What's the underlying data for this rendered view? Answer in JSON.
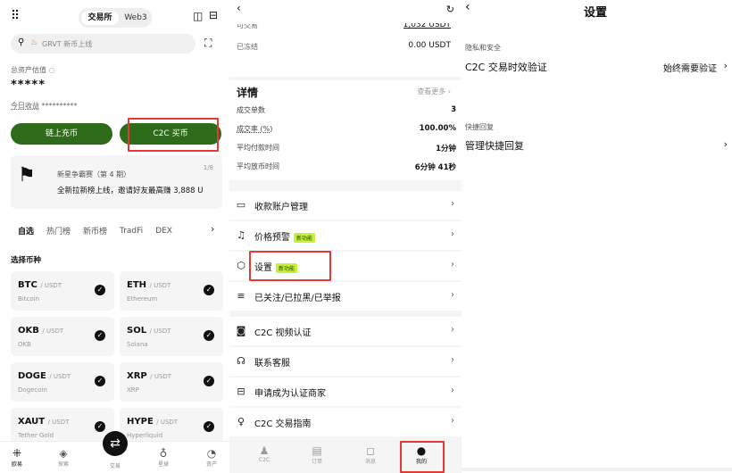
{
  "left": {
    "seg_on": "交易所",
    "seg_off": "Web3",
    "search_placeholder": "GRVT 新币上线",
    "assets_label": "总资产估值",
    "assets_value": "*****",
    "income_label": "今日收益",
    "income_value": "**********",
    "btn_deposit": "链上充币",
    "btn_c2c": "C2C 买币",
    "promo_title": "新星争霸赛（第 4 期）",
    "promo_counter": "1/8",
    "promo_text": "全新拉新榜上线，邀请好友最高赚 3,888 U",
    "tabs": [
      "自选",
      "热门榜",
      "新币榜",
      "TradFi",
      "DEX"
    ],
    "section": "选择币种",
    "coins": [
      {
        "sym": "BTC",
        "quote": "/ USDT",
        "name": "Bitcoin"
      },
      {
        "sym": "ETH",
        "quote": "/ USDT",
        "name": "Ethereum"
      },
      {
        "sym": "OKB",
        "quote": "/ USDT",
        "name": "OKB"
      },
      {
        "sym": "SOL",
        "quote": "/ USDT",
        "name": "Solana"
      },
      {
        "sym": "DOGE",
        "quote": "/ USDT",
        "name": "Dogecoin"
      },
      {
        "sym": "XRP",
        "quote": "/ USDT",
        "name": "XRP"
      },
      {
        "sym": "XAUT",
        "quote": "/ USDT",
        "name": "Tether Gold"
      },
      {
        "sym": "HYPE",
        "quote": "/ USDT",
        "name": "Hyperliquid"
      }
    ],
    "nav": [
      "欧易",
      "探索",
      "交易",
      "星球",
      "资产"
    ]
  },
  "middle": {
    "avail_label": "可交易",
    "avail_value": "1,032 USDT",
    "frozen_label": "已冻结",
    "frozen_value": "0.00 USDT",
    "details_title": "详情",
    "see_more": "查看更多 ›",
    "details": [
      {
        "k": "成交单数",
        "v": "3"
      },
      {
        "k": "成交率 (%)",
        "v": "100.00%"
      },
      {
        "k": "平均付款时间",
        "v": "1分钟"
      },
      {
        "k": "平均放币时间",
        "v": "6分钟 41秒"
      }
    ],
    "menu": [
      {
        "label": "收款账户管理",
        "icon": "card-icon",
        "glyph": "▭",
        "badge": ""
      },
      {
        "label": "价格预警",
        "icon": "bell-icon",
        "glyph": "🔔︎",
        "badge": "新功能"
      },
      {
        "label": "设置",
        "icon": "settings-icon",
        "glyph": "⬡",
        "badge": "新功能"
      },
      {
        "label": "已关注/已拉黑/已举报",
        "icon": "follow-icon",
        "glyph": "≡",
        "badge": ""
      },
      {
        "label": "C2C 视频认证",
        "icon": "camera-icon",
        "glyph": "◙",
        "badge": ""
      },
      {
        "label": "联系客服",
        "icon": "headset-icon",
        "glyph": "☊",
        "badge": ""
      },
      {
        "label": "申请成为认证商家",
        "icon": "merchant-icon",
        "glyph": "⊟",
        "badge": ""
      },
      {
        "label": "C2C 交易指南",
        "icon": "guide-icon",
        "glyph": "♀",
        "badge": ""
      }
    ],
    "nav": [
      "C2C",
      "订单",
      "消息",
      "我的"
    ]
  },
  "right": {
    "title": "设置",
    "privacy_section": "隐私和安全",
    "c2c_verify_label": "C2C 交易时效验证",
    "c2c_verify_value": "始终需要验证",
    "quick_section": "快捷回复",
    "quick_label": "管理快捷回复"
  }
}
